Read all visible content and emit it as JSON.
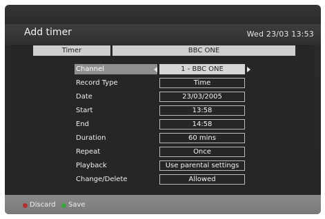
{
  "header": {
    "title": "Add timer",
    "datetime": "Wed 23/03 13:53"
  },
  "tabs": {
    "left": "Timer",
    "right": "BBC ONE"
  },
  "rows": [
    {
      "label": "Channel",
      "value": "1 - BBC ONE"
    },
    {
      "label": "Record Type",
      "value": "Time"
    },
    {
      "label": "Date",
      "value": "23/03/2005"
    },
    {
      "label": "Start",
      "value": "13:58"
    },
    {
      "label": "End",
      "value": "14:58"
    },
    {
      "label": "Duration",
      "value": "60 mins"
    },
    {
      "label": "Repeat",
      "value": "Once"
    },
    {
      "label": "Playback",
      "value": "Use parental settings"
    },
    {
      "label": "Change/Delete",
      "value": "Allowed"
    }
  ],
  "footer": {
    "discard_label": "Discard",
    "save_label": "Save",
    "discard_color": "#b03030",
    "save_color": "#3aa040"
  }
}
